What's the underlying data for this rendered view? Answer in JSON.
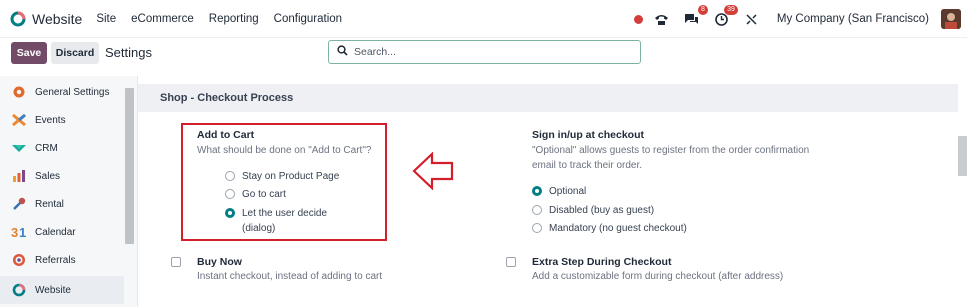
{
  "app": {
    "title": "Website"
  },
  "menu": {
    "items": [
      "Site",
      "eCommerce",
      "Reporting",
      "Configuration"
    ]
  },
  "systray": {
    "messages_badge": "8",
    "activity_badge": "39",
    "company": "My Company (San Francisco)"
  },
  "toolbar": {
    "save_label": "Save",
    "discard_label": "Discard",
    "page_title": "Settings"
  },
  "search": {
    "placeholder": "Search..."
  },
  "sidebar": {
    "items": [
      {
        "label": "General Settings",
        "icon": "settings-gear-icon"
      },
      {
        "label": "Events",
        "icon": "events-icon"
      },
      {
        "label": "CRM",
        "icon": "crm-icon"
      },
      {
        "label": "Sales",
        "icon": "sales-chart-icon"
      },
      {
        "label": "Rental",
        "icon": "rental-key-icon"
      },
      {
        "label": "Calendar",
        "icon": "calendar-icon"
      },
      {
        "label": "Referrals",
        "icon": "referrals-icon"
      },
      {
        "label": "Website",
        "icon": "website-icon"
      }
    ],
    "active": "Website"
  },
  "section": {
    "title": "Shop - Checkout Process"
  },
  "add_to_cart": {
    "title": "Add to Cart",
    "description": "What should be done on \"Add to Cart\"?",
    "options": [
      "Stay on Product Page",
      "Go to cart",
      "Let the user decide",
      "(dialog)"
    ],
    "selected": "Let the user decide"
  },
  "signin": {
    "title": "Sign in/up at checkout",
    "description_1": "\"Optional\" allows guests to register from the order confirmation",
    "description_2": "email to track their order.",
    "options": [
      "Optional",
      "Disabled (buy as guest)",
      "Mandatory (no guest checkout)"
    ],
    "selected": "Optional"
  },
  "buy_now": {
    "title": "Buy Now",
    "description": "Instant checkout, instead of adding to cart"
  },
  "extra_step": {
    "title": "Extra Step During Checkout",
    "description": "Add a customizable form during checkout (after address)"
  },
  "colors": {
    "brand": "#714b67",
    "accent": "#017e84",
    "annotation": "#d21f2b"
  }
}
